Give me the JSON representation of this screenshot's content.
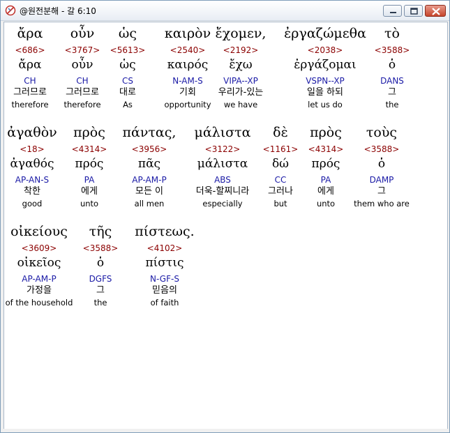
{
  "window": {
    "title": "@원전분해 - 갈 6:10",
    "controls": [
      "minimize-icon",
      "maximize-icon",
      "close-icon"
    ]
  },
  "rows": [
    [
      {
        "greek": "ἄρα",
        "strong": "<686>",
        "lemma": "ἄρα",
        "parse": "CH",
        "korean": "그러므로",
        "english": "therefore"
      },
      {
        "greek": "οὖν",
        "strong": "<3767>",
        "lemma": "οὖν",
        "parse": "CH",
        "korean": "그러므로",
        "english": "therefore"
      },
      {
        "greek": "ὡς",
        "strong": "<5613>",
        "lemma": "ὡς",
        "parse": "CS",
        "korean": "대로",
        "english": "As"
      },
      {
        "greek": "καιρὸν",
        "strong": "<2540>",
        "lemma": "καιρός",
        "parse": "N-AM-S",
        "korean": "기회",
        "english": "opportunity"
      },
      {
        "greek": "ἔχομεν,",
        "strong": "<2192>",
        "lemma": "ἔχω",
        "parse": "VIPA--XP",
        "korean": "우리가-있는",
        "english": "we have"
      },
      {
        "greek": "ἐργαζώμεθα",
        "strong": "<2038>",
        "lemma": "ἐργάζομαι",
        "parse": "VSPN--XP",
        "korean": "일을 하되",
        "english": "let us do"
      },
      {
        "greek": "τὸ",
        "strong": "<3588>",
        "lemma": "ὁ",
        "parse": "DANS",
        "korean": "그",
        "english": "the"
      }
    ],
    [
      {
        "greek": "ἀγαθὸν",
        "strong": "<18>",
        "lemma": "ἀγαθός",
        "parse": "AP-AN-S",
        "korean": "착한",
        "english": "good"
      },
      {
        "greek": "πρὸς",
        "strong": "<4314>",
        "lemma": "πρός",
        "parse": "PA",
        "korean": "에게",
        "english": "unto"
      },
      {
        "greek": "πάντας,",
        "strong": "<3956>",
        "lemma": "πᾶς",
        "parse": "AP-AM-P",
        "korean": "모든 이",
        "english": "all men"
      },
      {
        "greek": "μάλιστα",
        "strong": "<3122>",
        "lemma": "μάλιστα",
        "parse": "ABS",
        "korean": "더욱-할찌니라",
        "english": "especially"
      },
      {
        "greek": "δὲ",
        "strong": "<1161>",
        "lemma": "δώ",
        "parse": "CC",
        "korean": "그러나",
        "english": "but"
      },
      {
        "greek": "πρὸς",
        "strong": "<4314>",
        "lemma": "πρός",
        "parse": "PA",
        "korean": "에게",
        "english": "unto"
      },
      {
        "greek": "τοὺς",
        "strong": "<3588>",
        "lemma": "ὁ",
        "parse": "DAMP",
        "korean": "그",
        "english": "them who are"
      }
    ],
    [
      {
        "greek": "οἰκείους",
        "strong": "<3609>",
        "lemma": "οἰκεῖος",
        "parse": "AP-AM-P",
        "korean": "가정을",
        "english": "of the household"
      },
      {
        "greek": "τῆς",
        "strong": "<3588>",
        "lemma": "ὁ",
        "parse": "DGFS",
        "korean": "그",
        "english": "the"
      },
      {
        "greek": "πίστεως.",
        "strong": "<4102>",
        "lemma": "πίστις",
        "parse": "N-GF-S",
        "korean": "믿음의",
        "english": "of faith"
      }
    ]
  ]
}
